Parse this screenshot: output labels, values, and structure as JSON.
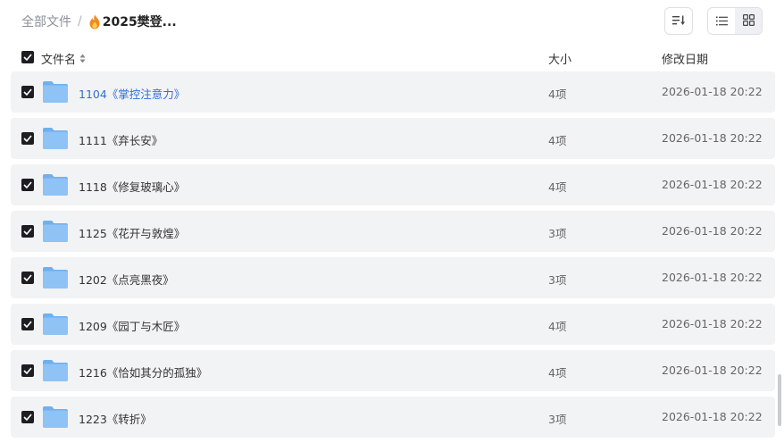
{
  "breadcrumb": {
    "root": "全部文件",
    "separator": "/",
    "current": "2025樊登..."
  },
  "header": {
    "name": "文件名",
    "size": "大小",
    "date": "修改日期"
  },
  "colors": {
    "link": "#2f6fd6",
    "row_bg": "#f2f3f5",
    "checkbox": "#1d1d22",
    "folder": "#8fc2f5"
  },
  "files": [
    {
      "name": "1104《掌控注意力》",
      "size": "4项",
      "date": "2026-01-18 20:22",
      "checked": true,
      "hovered": true
    },
    {
      "name": "1111《弃长安》",
      "size": "4项",
      "date": "2026-01-18 20:22",
      "checked": true
    },
    {
      "name": "1118《修复玻璃心》",
      "size": "4项",
      "date": "2026-01-18 20:22",
      "checked": true
    },
    {
      "name": "1125《花开与敦煌》",
      "size": "3项",
      "date": "2026-01-18 20:22",
      "checked": true
    },
    {
      "name": "1202《点亮黑夜》",
      "size": "3项",
      "date": "2026-01-18 20:22",
      "checked": true
    },
    {
      "name": "1209《园丁与木匠》",
      "size": "4项",
      "date": "2026-01-18 20:22",
      "checked": true
    },
    {
      "name": "1216《恰如其分的孤独》",
      "size": "4项",
      "date": "2026-01-18 20:22",
      "checked": true
    },
    {
      "name": "1223《转折》",
      "size": "3项",
      "date": "2026-01-18 20:22",
      "checked": true
    }
  ]
}
